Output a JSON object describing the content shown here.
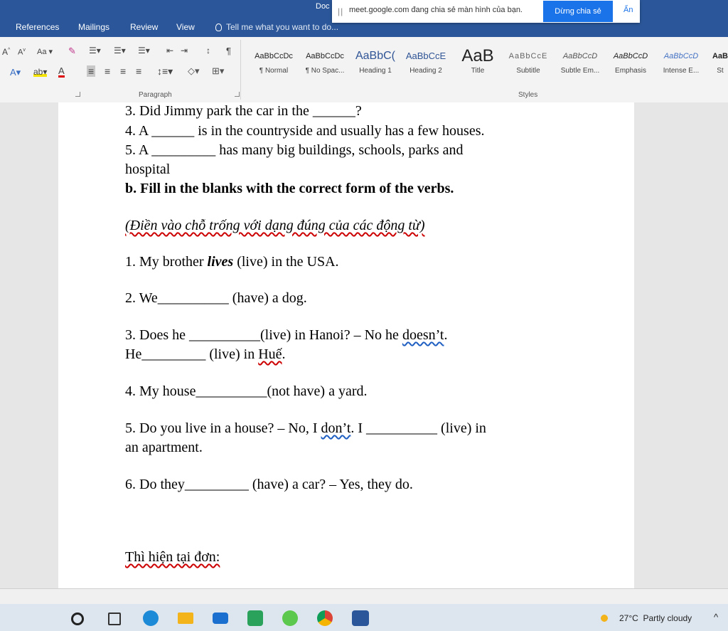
{
  "window": {
    "doc_title": "Doc"
  },
  "ribbon_tabs": [
    "References",
    "Mailings",
    "Review",
    "View"
  ],
  "tell_me": "Tell me what you want to do...",
  "share_bar": {
    "handle": "||",
    "message": "meet.google.com đang chia sẻ màn hình của bạn.",
    "stop_button": "Dừng chia sẻ",
    "hide_button": "Ẩn"
  },
  "ribbon": {
    "font_grow": "A",
    "font_shrink": "A",
    "change_case": "Aa",
    "pilcrow": "¶",
    "paragraph_label": "Paragraph",
    "styles_label": "Styles",
    "styles": [
      {
        "sample": "AaBbCcDc",
        "name": "¶ Normal"
      },
      {
        "sample": "AaBbCcDc",
        "name": "¶ No Spac..."
      },
      {
        "sample": "AaBbC(",
        "name": "Heading 1"
      },
      {
        "sample": "AaBbCcE",
        "name": "Heading 2"
      },
      {
        "sample": "AaB",
        "name": "Title"
      },
      {
        "sample": "AaBbCcE",
        "name": "Subtitle"
      },
      {
        "sample": "AaBbCcD",
        "name": "Subtle Em..."
      },
      {
        "sample": "AaBbCcD",
        "name": "Emphasis"
      },
      {
        "sample": "AaBbCcD",
        "name": "Intense E..."
      },
      {
        "sample": "AaB",
        "name": "St"
      }
    ]
  },
  "document": {
    "q3": [
      "3. Did Jimmy park the car in the ",
      "______",
      "?"
    ],
    "q4": [
      "4. A ",
      "______",
      " is in the countryside and usually has a few houses."
    ],
    "q5a": [
      "5. A ",
      "_________",
      " has many big buildings, schools, parks and"
    ],
    "q5b": "hospital",
    "section_b": "b. Fill in the blanks with the correct form of the verbs.",
    "section_b_vi": "(Điền vào chỗ trống với dạng đúng của các động từ)",
    "e1": [
      "1. My brother ",
      "lives",
      " (live) in the USA."
    ],
    "e2": [
      "2. We",
      "__________",
      " (have) a dog."
    ],
    "e3a": [
      "3. Does he ",
      "__________",
      "(live) in Hanoi? – No he ",
      "doesn’t",
      "."
    ],
    "e3b": [
      "He",
      "_________",
      " (live) in ",
      "Huế",
      "."
    ],
    "e4": [
      "4. My house",
      "__________",
      "(not have) a yard."
    ],
    "e5a": [
      "5. Do you live in a house? – No, I ",
      "don’t",
      ". I ",
      "__________",
      " (live) in"
    ],
    "e5b": "an apartment.",
    "e6": [
      "6. Do they",
      "_________",
      " (have) a car? – Yes, they do."
    ],
    "heading_tense": "Thì hiện tại đơn:"
  },
  "taskbar": {
    "temperature": "27°C",
    "condition": "Partly cloudy",
    "chevron": "^"
  },
  "colors": {
    "word_blue": "#2b579a",
    "meet_blue": "#1a73e8",
    "proofing_red": "#cc0000"
  }
}
